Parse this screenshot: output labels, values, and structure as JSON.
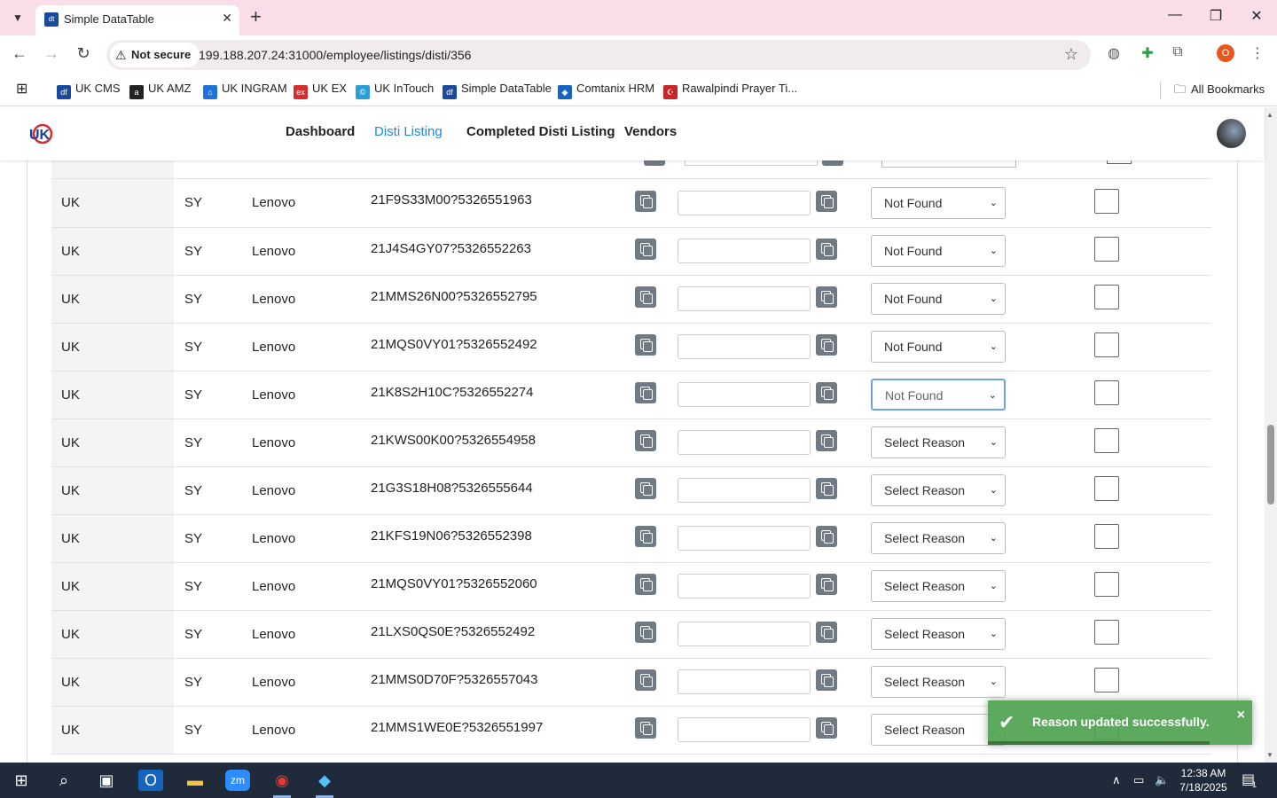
{
  "browser": {
    "tab_title": "Simple DataTable",
    "tab_favicon": "dt",
    "not_secure": "Not secure",
    "url": "199.188.207.24:31000/employee/listings/disti/356",
    "profile_initial": "O"
  },
  "bookmarks": [
    {
      "label": "UK CMS",
      "color": "#1a4a9c",
      "glyph": "df"
    },
    {
      "label": "UK AMZ",
      "color": "#222222",
      "glyph": "a"
    },
    {
      "label": "UK INGRAM",
      "color": "#1e73d8",
      "glyph": "⌂"
    },
    {
      "label": "UK EX",
      "color": "#d32f2f",
      "glyph": "ex"
    },
    {
      "label": "UK InTouch",
      "color": "#2a9fd6",
      "glyph": "©"
    },
    {
      "label": "Simple DataTable",
      "color": "#1a4a9c",
      "glyph": "df"
    },
    {
      "label": "Comtanix HRM",
      "color": "#1565c0",
      "glyph": "◆"
    },
    {
      "label": "Rawalpindi Prayer Ti...",
      "color": "#c62828",
      "glyph": "☪"
    }
  ],
  "all_bookmarks": "All Bookmarks",
  "nav": {
    "items": [
      "Dashboard",
      "Disti Listing",
      "Completed Disti Listing",
      "Vendors"
    ],
    "active": "Disti Listing"
  },
  "rows": [
    {
      "country": "UK",
      "code": "SY",
      "brand": "Lenovo",
      "sku": "21F9S33M00?5326551963",
      "reason": "Not Found"
    },
    {
      "country": "UK",
      "code": "SY",
      "brand": "Lenovo",
      "sku": "21J4S4GY07?5326552263",
      "reason": "Not Found"
    },
    {
      "country": "UK",
      "code": "SY",
      "brand": "Lenovo",
      "sku": "21MMS26N00?5326552795",
      "reason": "Not Found"
    },
    {
      "country": "UK",
      "code": "SY",
      "brand": "Lenovo",
      "sku": "21MQS0VY01?5326552492",
      "reason": "Not Found"
    },
    {
      "country": "UK",
      "code": "SY",
      "brand": "Lenovo",
      "sku": "21K8S2H10C?5326552274",
      "reason": "Not Found"
    },
    {
      "country": "UK",
      "code": "SY",
      "brand": "Lenovo",
      "sku": "21KWS00K00?5326554958",
      "reason": "Select Reason"
    },
    {
      "country": "UK",
      "code": "SY",
      "brand": "Lenovo",
      "sku": "21G3S18H08?5326555644",
      "reason": "Select Reason"
    },
    {
      "country": "UK",
      "code": "SY",
      "brand": "Lenovo",
      "sku": "21KFS19N06?5326552398",
      "reason": "Select Reason"
    },
    {
      "country": "UK",
      "code": "SY",
      "brand": "Lenovo",
      "sku": "21MQS0VY01?5326552060",
      "reason": "Select Reason"
    },
    {
      "country": "UK",
      "code": "SY",
      "brand": "Lenovo",
      "sku": "21LXS0QS0E?5326552492",
      "reason": "Select Reason"
    },
    {
      "country": "UK",
      "code": "SY",
      "brand": "Lenovo",
      "sku": "21MMS0D70F?5326557043",
      "reason": "Select Reason"
    },
    {
      "country": "UK",
      "code": "SY",
      "brand": "Lenovo",
      "sku": "21MMS1WE0E?5326551997",
      "reason": "Select Reason"
    }
  ],
  "toast": {
    "message": "Reason updated successfully.",
    "close": "×"
  },
  "taskbar": {
    "time": "12:38 AM",
    "date": "7/18/2025",
    "notifications": "1"
  },
  "colors": {
    "accent": "#1e88e5",
    "toast": "#51a351",
    "tab_strip": "#f9dde8"
  }
}
